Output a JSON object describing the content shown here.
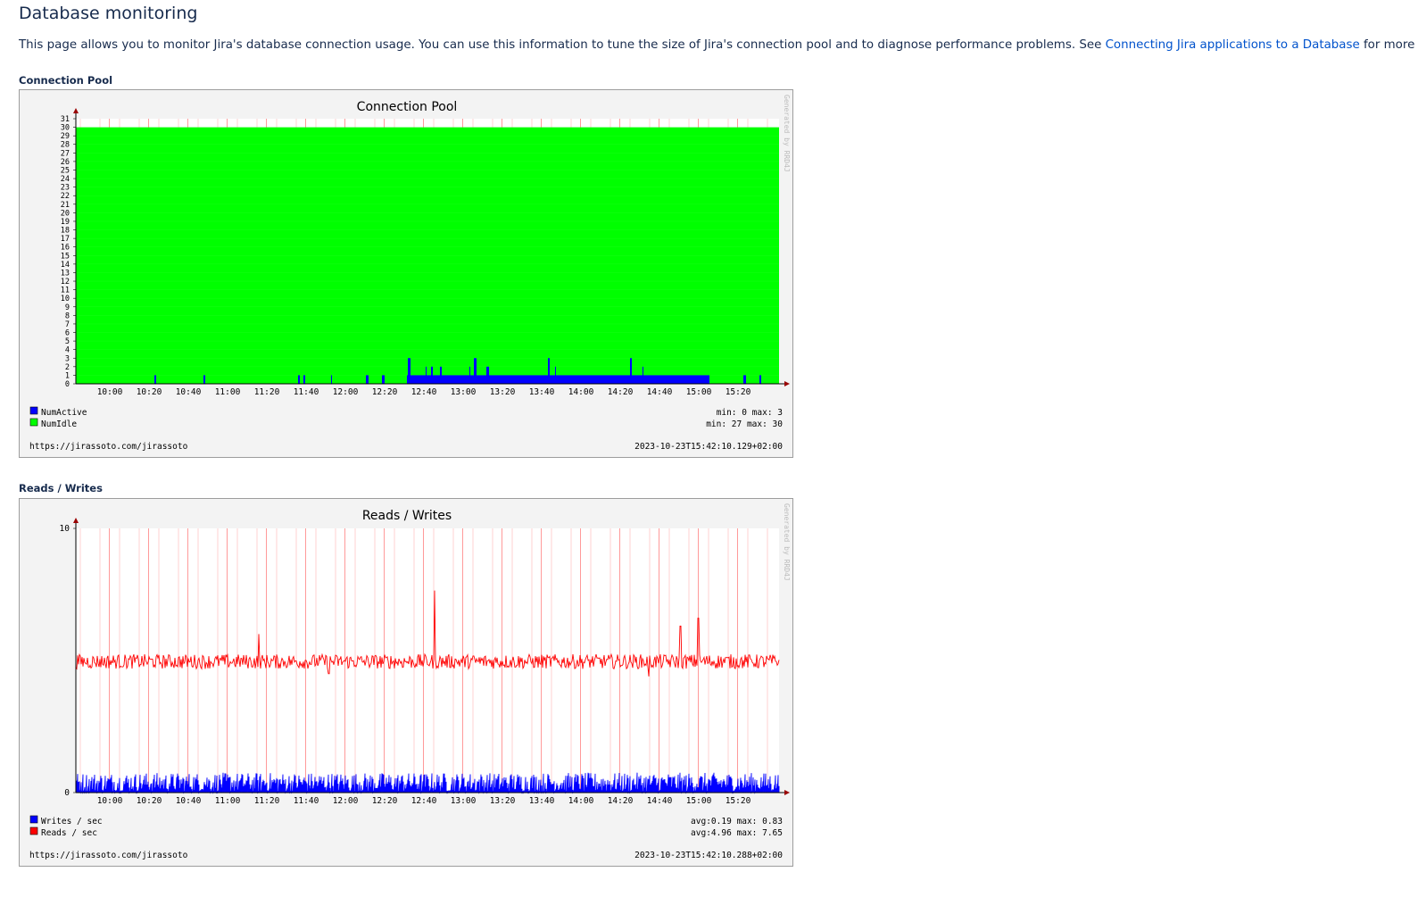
{
  "page": {
    "title": "Database monitoring",
    "intro_text": "This page allows you to monitor Jira's database connection usage. You can use this information to tune the size of Jira's connection pool and to diagnose performance problems. See ",
    "intro_link": "Connecting Jira applications to a Database",
    "intro_suffix": " for more info."
  },
  "colors": {
    "num_active": "#0000ff",
    "num_idle": "#00ff00",
    "writes": "#0000ff",
    "reads": "#ff0000",
    "link": "#0052cc"
  },
  "graphs": [
    {
      "section_label": "Connection Pool",
      "title": "Connection Pool",
      "generator": "Generated by RRD4J",
      "url": "https://jirassoto.com/jirassoto",
      "timestamp": "2023-10-23T15:42:10.129+02:00",
      "legend": [
        {
          "name": "NumActive",
          "stats": "min: 0  max: 3",
          "color_key": "num_active"
        },
        {
          "name": "NumIdle",
          "stats": "min: 27  max: 30",
          "color_key": "num_idle"
        }
      ]
    },
    {
      "section_label": "Reads / Writes",
      "title": "Reads / Writes",
      "generator": "Generated by RRD4J",
      "url": "https://jirassoto.com/jirassoto",
      "timestamp": "2023-10-23T15:42:10.288+02:00",
      "legend": [
        {
          "name": "Writes / sec",
          "stats": "avg:0.19  max: 0.83",
          "color_key": "writes"
        },
        {
          "name": "Reads / sec",
          "stats": "avg:4.96  max: 7.65",
          "color_key": "reads"
        }
      ]
    }
  ],
  "chart_data": [
    {
      "type": "area",
      "title": "Connection Pool",
      "x_tick_labels": [
        "10:00",
        "10:20",
        "10:40",
        "11:00",
        "11:20",
        "11:40",
        "12:00",
        "12:20",
        "12:40",
        "13:00",
        "13:20",
        "13:40",
        "14:00",
        "14:20",
        "14:40",
        "15:00",
        "15:20"
      ],
      "ylim": [
        0,
        31
      ],
      "y_tick_labels": [
        "0",
        "1",
        "2",
        "3",
        "4",
        "5",
        "6",
        "7",
        "8",
        "9",
        "10",
        "11",
        "12",
        "13",
        "14",
        "15",
        "16",
        "17",
        "18",
        "19",
        "20",
        "21",
        "22",
        "23",
        "24",
        "25",
        "26",
        "27",
        "28",
        "29",
        "30",
        "31"
      ],
      "stacked": true,
      "series": [
        {
          "name": "NumActive",
          "min": 0,
          "max": 3
        },
        {
          "name": "NumIdle",
          "min": 27,
          "max": 30
        }
      ]
    },
    {
      "type": "line",
      "title": "Reads / Writes",
      "x_tick_labels": [
        "10:00",
        "10:20",
        "10:40",
        "11:00",
        "11:20",
        "11:40",
        "12:00",
        "12:20",
        "12:40",
        "13:00",
        "13:20",
        "13:40",
        "14:00",
        "14:20",
        "14:40",
        "15:00",
        "15:20"
      ],
      "ylim": [
        0,
        10
      ],
      "y_tick_labels": [
        "0",
        "10"
      ],
      "series": [
        {
          "name": "Writes / sec",
          "avg": 0.19,
          "max": 0.83
        },
        {
          "name": "Reads / sec",
          "avg": 4.96,
          "max": 7.65
        }
      ]
    }
  ]
}
